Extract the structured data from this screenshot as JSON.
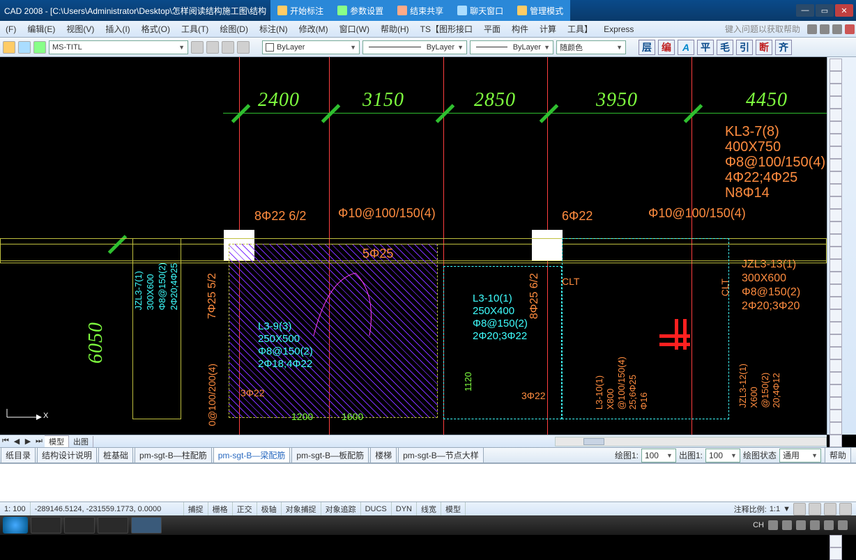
{
  "titlebar": {
    "app": "CAD 2008 - [C:\\Users\\Administrator\\Desktop\\怎样阅读结构施工图\\结构",
    "btns": [
      "开始标注",
      "参数设置",
      "结束共享",
      "聊天窗口",
      "管理模式"
    ]
  },
  "menu": [
    "(F)",
    "编辑(E)",
    "视图(V)",
    "插入(I)",
    "格式(O)",
    "工具(T)",
    "绘图(D)",
    "标注(N)",
    "修改(M)",
    "窗口(W)",
    "帮助(H)",
    "TS【图形接口",
    "平面",
    "构件",
    "计算",
    "工具】",
    "Express"
  ],
  "menu_hint": "键入问题以获取帮助",
  "toolbar": {
    "style_combo": "MS-TITL",
    "layer_label": "ByLayer",
    "ltype_label": "ByLayer",
    "lweight_label": "ByLayer",
    "color_label": "随颜色",
    "cn_btns": [
      "层",
      "编",
      "",
      "平",
      "毛",
      "引",
      "断",
      "齐"
    ]
  },
  "drawing": {
    "dims_top": [
      "2400",
      "3150",
      "2850",
      "3950",
      "4450"
    ],
    "dim_left": "6050",
    "beam_right": [
      "KL3-7(8)",
      "400X750",
      "Φ8@100/150(4)",
      "4Φ22;4Φ25",
      "N8Φ14"
    ],
    "beam_right2": [
      "JZL3-13(1)",
      "300X600",
      "Φ8@150(2)",
      "2Φ20;3Φ20"
    ],
    "label_822": "8Φ22  6/2",
    "label_622": "6Φ22",
    "label_top1": "Φ10@100/150(4)",
    "label_top2": "Φ10@100/150(4)",
    "label_525": "5Φ25",
    "label_725": "7Φ25 5/2",
    "label_825": "8Φ25 6/2",
    "beam_l39": [
      "L3-9(3)",
      "250X500",
      "Φ8@150(2)",
      "2Φ18;4Φ22"
    ],
    "beam_l310": [
      "L3-10(1)",
      "250X400",
      "Φ8@150(2)",
      "2Φ20;3Φ22"
    ],
    "beam_l310b": [
      "L3-10(1)",
      "X800",
      "@100/150(4)",
      "25;6Φ25",
      "Φ16"
    ],
    "beam_jzl37": [
      "JZL3-7(1)",
      "300X600",
      "Φ8@150(2)",
      "2Φ20;4Φ25"
    ],
    "beam_jzl312": [
      "JZL3-12(1)",
      "X600",
      "@150(2)",
      "20;4Φ12"
    ],
    "label_322a": "3Φ22",
    "label_322b": "3Φ22",
    "label_1200": "1200",
    "label_1600": "1600",
    "label_1120": "1120",
    "label_clt1": "CLT",
    "label_clt2": "CLT",
    "label_100200": "0@100/200(4)",
    "ucs_x": "X"
  },
  "mtabs": {
    "active": "模型",
    "other": "出图"
  },
  "sheet_tabs": [
    "纸目录",
    "结构设计说明",
    "桩基础",
    "pm-sgt-B—柱配筋",
    "pm-sgt-B—梁配筋",
    "pm-sgt-B—板配筋",
    "楼梯",
    "pm-sgt-B—节点大样"
  ],
  "sheet_active": "pm-sgt-B—梁配筋",
  "sheet_right": {
    "l1": "绘图1:",
    "v1": "100",
    "l2": "出图1:",
    "v2": "100",
    "l3": "绘图状态",
    "v3": "通用",
    "help": "帮助"
  },
  "status": {
    "scale": "1: 100",
    "coords": "-289146.5124, -231559.1773, 0.0000",
    "toggles": [
      "捕捉",
      "栅格",
      "正交",
      "极轴",
      "对象捕捉",
      "对象追踪",
      "DUCS",
      "DYN",
      "线宽",
      "模型"
    ],
    "anno_label": "注释比例:",
    "anno_val": "1:1"
  },
  "taskbar": {
    "ime": "CH"
  }
}
